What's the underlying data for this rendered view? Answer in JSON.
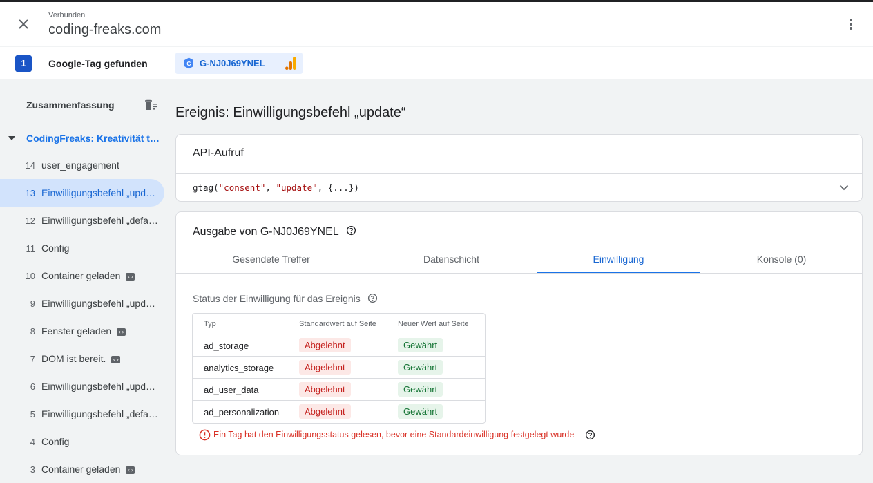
{
  "header": {
    "status": "Verbunden",
    "domain": "coding-freaks.com"
  },
  "tagbar": {
    "count": "1",
    "found_label": "Google-Tag gefunden",
    "tag_id": "G-NJ0J69YNEL"
  },
  "sidebar": {
    "summary_label": "Zusammenfassung",
    "page_title": "CodingFreaks: Kreativität trifft Technik",
    "items": [
      {
        "num": "14",
        "label": "user_engagement",
        "code": false,
        "active": false
      },
      {
        "num": "13",
        "label": "Einwilligungsbefehl „update“",
        "code": false,
        "active": true
      },
      {
        "num": "12",
        "label": "Einwilligungsbefehl „default“",
        "code": false,
        "active": false
      },
      {
        "num": "11",
        "label": "Config",
        "code": false,
        "active": false
      },
      {
        "num": "10",
        "label": "Container geladen",
        "code": true,
        "active": false
      },
      {
        "num": "9",
        "label": "Einwilligungsbefehl „update“",
        "code": false,
        "active": false
      },
      {
        "num": "8",
        "label": "Fenster geladen",
        "code": true,
        "active": false
      },
      {
        "num": "7",
        "label": "DOM ist bereit.",
        "code": true,
        "active": false
      },
      {
        "num": "6",
        "label": "Einwilligungsbefehl „update“",
        "code": false,
        "active": false
      },
      {
        "num": "5",
        "label": "Einwilligungsbefehl „default“",
        "code": false,
        "active": false
      },
      {
        "num": "4",
        "label": "Config",
        "code": false,
        "active": false
      },
      {
        "num": "3",
        "label": "Container geladen",
        "code": true,
        "active": false
      }
    ]
  },
  "main": {
    "title": "Ereignis: Einwilligungsbefehl „update“",
    "api_card": {
      "title": "API-Aufruf",
      "code_prefix": "gtag(",
      "arg1": "\"consent\"",
      "comma1": ", ",
      "arg2": "\"update\"",
      "code_suffix": ", {...})"
    },
    "output_card": {
      "title": "Ausgabe von G-NJ0J69YNEL",
      "tabs": [
        "Gesendete Treffer",
        "Datenschicht",
        "Einwilligung",
        "Konsole (0)"
      ],
      "active_tab": 2,
      "consent_heading": "Status der Einwilligung für das Ereignis",
      "table": {
        "headers": [
          "Typ",
          "Standardwert auf Seite",
          "Neuer Wert auf Seite"
        ],
        "rows": [
          {
            "type": "ad_storage",
            "default": "Abgelehnt",
            "new": "Gewährt"
          },
          {
            "type": "analytics_storage",
            "default": "Abgelehnt",
            "new": "Gewährt"
          },
          {
            "type": "ad_user_data",
            "default": "Abgelehnt",
            "new": "Gewährt"
          },
          {
            "type": "ad_personalization",
            "default": "Abgelehnt",
            "new": "Gewährt"
          }
        ]
      },
      "warning": "Ein Tag hat den Einwilligungsstatus gelesen, bevor eine Standardeinwilligung festgelegt wurde"
    }
  },
  "colors": {
    "accent": "#1a73e8",
    "denied_bg": "#fce8e6",
    "denied_text": "#c5221f",
    "granted_bg": "#e6f4ea",
    "granted_text": "#137333",
    "warning": "#d93025"
  }
}
